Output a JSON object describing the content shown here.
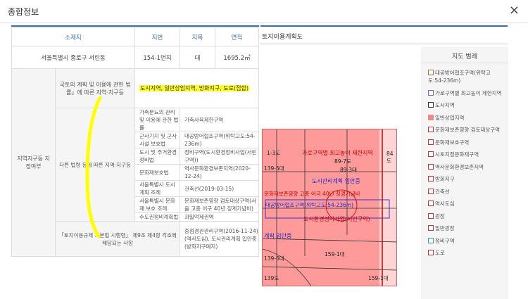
{
  "dialog": {
    "title": "종합정보",
    "close": "×"
  },
  "table": {
    "headers": [
      "소재지",
      "지번",
      "지목",
      "면적"
    ],
    "row1": {
      "address": "서울특별시 종로구 서린동",
      "lot": "154-1번지",
      "category": "대",
      "area": "1695.2㎡"
    },
    "zone_label": "지역지구등 지정여부",
    "national_label": "국토의 계획 및 이용에 관한 법률」에 따른 지역·지구등",
    "national_value": "도시지역, 일반상업지역, 방화지구, 도로(접합)",
    "other_label": "다른 법령 등에 따른 지역·지구등",
    "sub": [
      {
        "law": "가축분뇨의 관리 및 이용에 관한 법률",
        "value": "가축사육제한구역"
      },
      {
        "law": "군사기지 및 군사시설 보호법",
        "value": "대공방어협조구역(위탁고도:54-236m)"
      },
      {
        "law": "도시 및 주거환경정비법",
        "value": "정비구역(도시환경정비사업(서린구역))"
      },
      {
        "law": "문화재보호법",
        "value": "역사문화환경보존지역(2020-12-24)"
      },
      {
        "law": "서울특별시 도시계획 조례",
        "value": "건축선(2019-03-15)"
      },
      {
        "law": "서울특별시 문화재 보호 조례",
        "value": "문화재보존영향 검토대상구역(서울 고층 어구 40년 징계기념비)"
      },
      {
        "law": "수도권정비계획법",
        "value": "과밀억제권역"
      }
    ],
    "bottom_label": "「토지이용규제 기본법 시행령」 제9조 제4항 각호에 해당되는 사항",
    "bottom_value": "중점경관관리구역(2016-11-24)(역사도심), 도시관리계획 입안중(방화지구폐지)"
  },
  "map": {
    "title": "토지이용계획도",
    "labels": {
      "l1": "1-3도",
      "l2": "가로구역별 최고높이 제한지역",
      "l3": "89-7도",
      "l4": "84도",
      "l5": "139-5대",
      "l6": "89-3대",
      "l7": "도시관리계획 입안중",
      "l8": "문화재보존영향 고종 어극 40년 칭경기념비",
      "l9": "대공방어협조구역(위탁고도:54-236m)",
      "l10": "도시환경정비사업(서린구역)",
      "l11": "계획 입안중",
      "l12": "159-1대",
      "l13": "139-6대",
      "l14": "139도",
      "l15": "159-1대"
    }
  },
  "legend": {
    "title": "지도 범례",
    "items": [
      {
        "label": "대공방어협조구역(위탁고도:54-236m)",
        "color": "#a07040",
        "fill": "#ffffff"
      },
      {
        "label": "가로구역별 최고높이 제한지역",
        "color": "#9b59b6",
        "fill": "#ffffff"
      },
      {
        "label": "도시지역",
        "color": "#333333",
        "fill": "#ffffff"
      },
      {
        "label": "일반상업지역",
        "color": "#e88a8a",
        "fill": "#f08a8a"
      },
      {
        "label": "문화재보존영향 검토대상구역",
        "color": "#cc3333",
        "fill": "#ffffff"
      },
      {
        "label": "문화재보호구역",
        "color": "#cc3333",
        "fill": "#ffffff"
      },
      {
        "label": "시토지정문화재구역",
        "color": "#cc3333",
        "fill": "#ffffff"
      },
      {
        "label": "역사문화환경보존지역",
        "color": "#cc3333",
        "fill": "#ffffff"
      },
      {
        "label": "방화지구",
        "color": "#cc3333",
        "fill": "#ffffff"
      },
      {
        "label": "건축선",
        "color": "#cc3333",
        "fill": "#ffffff"
      },
      {
        "label": "역사도심",
        "color": "#cc3333",
        "fill": "#ffffff"
      },
      {
        "label": "광장",
        "color": "#cc3333",
        "fill": "#ffffff"
      },
      {
        "label": "일반광장",
        "color": "#cc3333",
        "fill": "#ffffff"
      },
      {
        "label": "정비구역",
        "color": "#3399cc",
        "fill": "#ffffff"
      },
      {
        "label": "도로",
        "color": "#cc3333",
        "fill": "#ffffff"
      }
    ]
  }
}
